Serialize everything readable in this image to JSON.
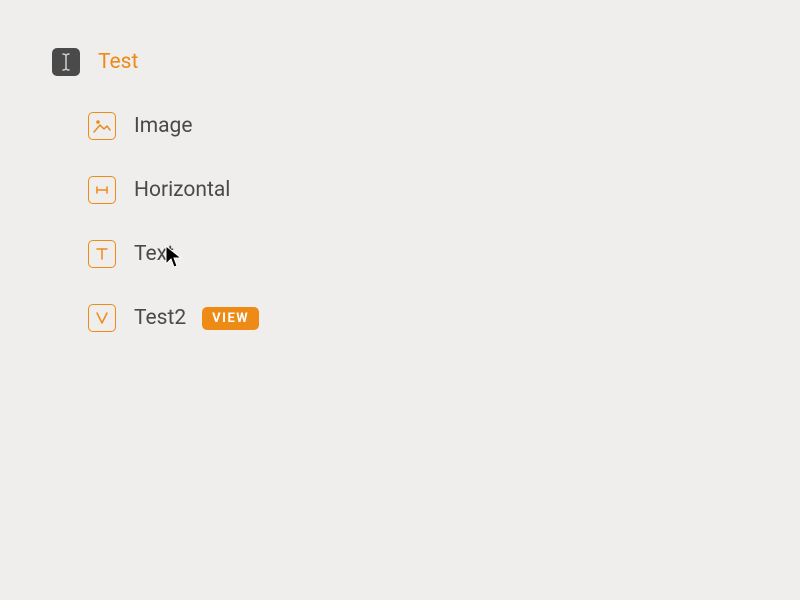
{
  "root": {
    "label": "Test"
  },
  "items": [
    {
      "label": "Image"
    },
    {
      "label": "Horizontal"
    },
    {
      "label": "Text"
    },
    {
      "label": "Test2",
      "badge": "VIEW"
    }
  ],
  "colors": {
    "accent": "#ee8a16",
    "text": "#4a4a4a",
    "bg": "#efeeec"
  }
}
